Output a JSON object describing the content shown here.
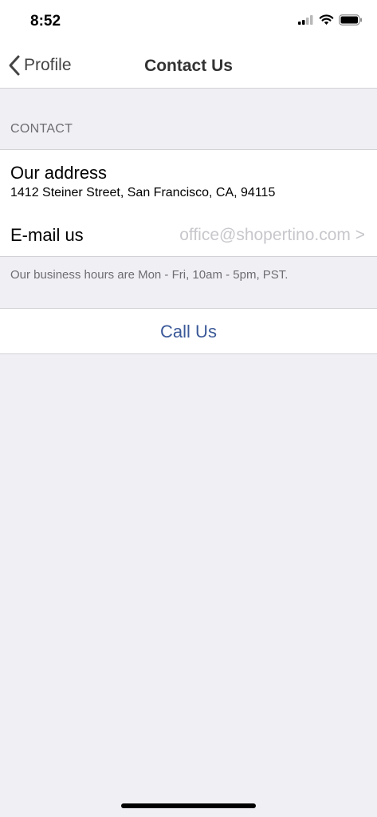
{
  "status_bar": {
    "time": "8:52",
    "icons": [
      "signal-icon",
      "wifi-icon",
      "battery-icon"
    ]
  },
  "nav": {
    "back_label": "Profile",
    "title": "Contact Us"
  },
  "contact": {
    "section_header": "CONTACT",
    "address_title": "Our address",
    "address_value": "1412 Steiner Street, San Francisco, CA, 94115",
    "email_label": "E-mail us",
    "email_value": "office@shopertino.com >",
    "footer_note": "Our business hours are Mon - Fri, 10am - 5pm, PST."
  },
  "call": {
    "label": "Call Us"
  },
  "colors": {
    "background": "#efeff4",
    "link": "#3b5998",
    "secondary_text": "#6d6d72",
    "placeholder_text": "#c7c7cc"
  }
}
